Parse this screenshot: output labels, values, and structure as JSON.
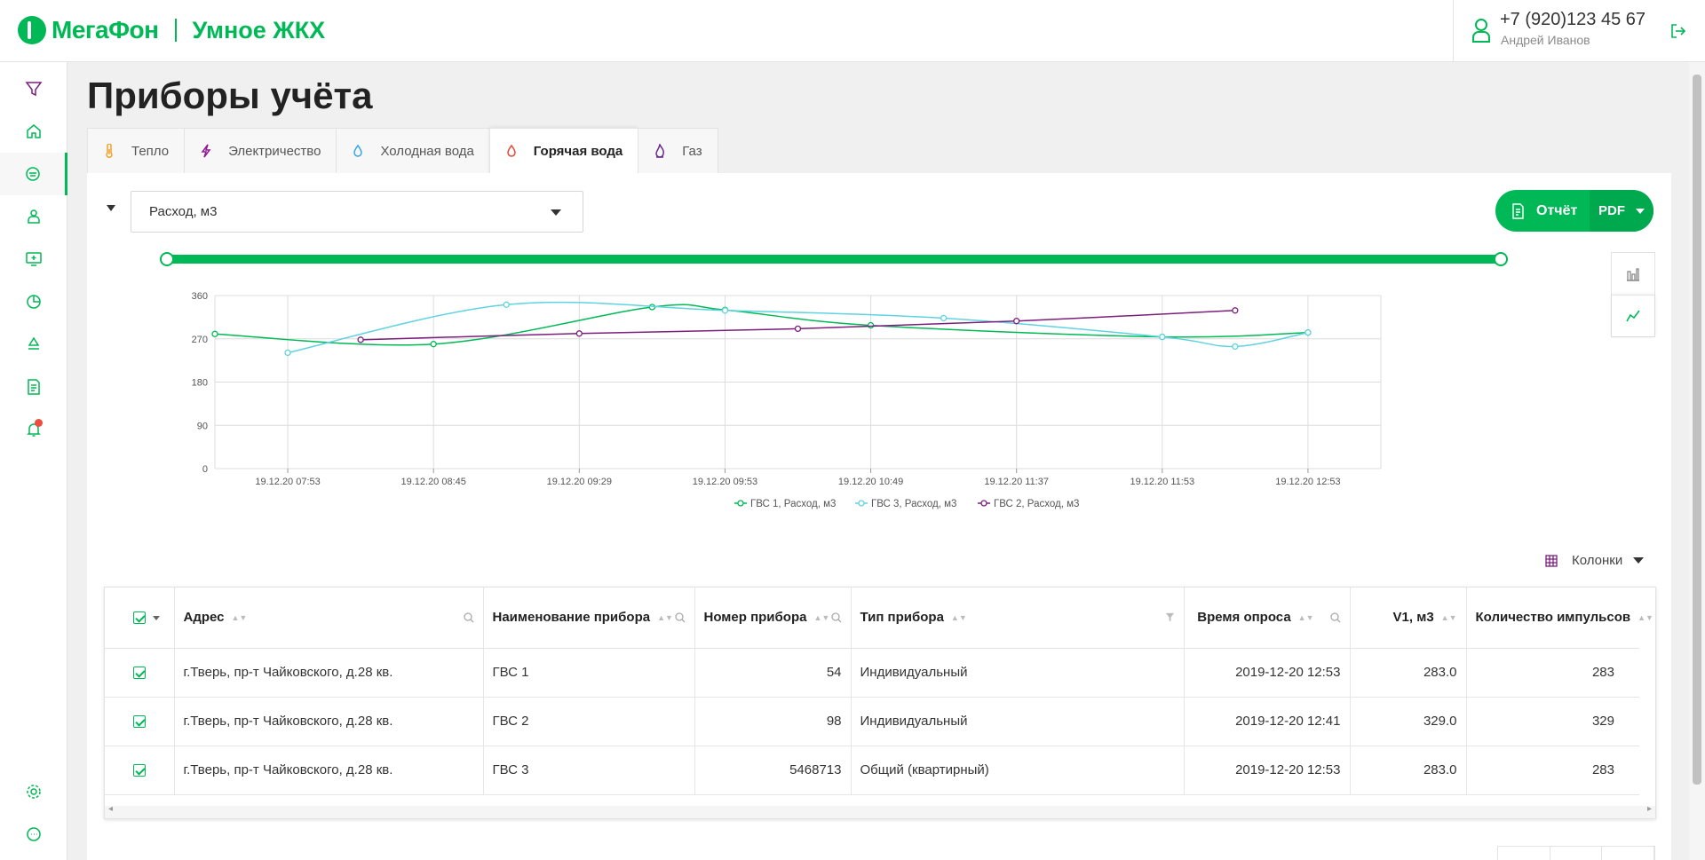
{
  "header": {
    "brand": "МегаФон",
    "product": "Умное ЖКХ",
    "user_phone": "+7 (920)123 45 67",
    "user_name": "Андрей Иванов"
  },
  "sidebar": {
    "items": [
      {
        "icon": "filter-icon"
      },
      {
        "icon": "home-icon"
      },
      {
        "icon": "meter-icon",
        "active": true
      },
      {
        "icon": "user-group-icon"
      },
      {
        "icon": "monitor-icon"
      },
      {
        "icon": "pie-chart-icon"
      },
      {
        "icon": "recycle-icon"
      },
      {
        "icon": "document-icon"
      },
      {
        "icon": "bell-icon",
        "badge": true
      },
      {
        "icon": "settings-icon"
      },
      {
        "icon": "chat-icon"
      }
    ]
  },
  "page": {
    "title": "Приборы учёта"
  },
  "tabs": [
    {
      "label": "Тепло",
      "icon": "thermometer-icon",
      "color": "#f2a12b"
    },
    {
      "label": "Электричество",
      "icon": "lightning-icon",
      "color": "#8e1b8f"
    },
    {
      "label": "Холодная вода",
      "icon": "water-drop-icon",
      "color": "#3aa8e0"
    },
    {
      "label": "Горячая вода",
      "icon": "hot-water-drop-icon",
      "color": "#e84a3a",
      "active": true
    },
    {
      "label": "Газ",
      "icon": "gas-flame-icon",
      "color": "#6b2a8a"
    }
  ],
  "filter": {
    "selected": "Расход, м3"
  },
  "report": {
    "label": "Отчёт",
    "format": "PDF"
  },
  "colors": {
    "accent": "#00b956",
    "series1": "#00b956",
    "series2": "#5fd3e0",
    "series3": "#7b1f7d"
  },
  "chart_data": {
    "type": "line",
    "ylim": [
      0,
      360
    ],
    "yticks": [
      0,
      90,
      180,
      270,
      360
    ],
    "categories": [
      "19.12.20 07:53",
      "19.12.20 08:45",
      "19.12.20 09:29",
      "19.12.20 09:53",
      "19.12.20 10:49",
      "19.12.20 11:37",
      "19.12.20 11:53",
      "19.12.20 12:53"
    ],
    "series": [
      {
        "name": "ГВС 1, Расход, м3",
        "color": "#00b956",
        "points": [
          [
            -0.5,
            280
          ],
          [
            1,
            259
          ],
          [
            2.5,
            336
          ],
          [
            3,
            330
          ],
          [
            4,
            298
          ],
          [
            6,
            274
          ],
          [
            7,
            283
          ]
        ]
      },
      {
        "name": "ГВС 3, Расход, м3",
        "color": "#5fd3e0",
        "points": [
          [
            0,
            241
          ],
          [
            1.5,
            341
          ],
          [
            3,
            329
          ],
          [
            4.5,
            313
          ],
          [
            6,
            274
          ],
          [
            6.5,
            254
          ],
          [
            7,
            283
          ]
        ]
      },
      {
        "name": "ГВС 2, Расход, м3",
        "color": "#7b1f7d",
        "points": [
          [
            0.5,
            268
          ],
          [
            2,
            281
          ],
          [
            3.5,
            291
          ],
          [
            5,
            307
          ],
          [
            6.5,
            329
          ]
        ]
      }
    ]
  },
  "columns_label": "Колонки",
  "table": {
    "headers": {
      "address": "Адрес",
      "device_name": "Наименование прибора",
      "device_number": "Номер прибора",
      "device_type": "Тип прибора",
      "poll_time": "Время опроса",
      "v1": "V1, м3",
      "pulses": "Количество импульсов"
    },
    "rows": [
      {
        "address": "г.Тверь, пр-т Чайковского, д.28 кв.",
        "device_name": "ГВС 1",
        "device_number": "54",
        "device_type": "Индивидуальный",
        "poll_time": "2019-12-20 12:53",
        "v1": "283.0",
        "pulses": "283"
      },
      {
        "address": "г.Тверь, пр-т Чайковского, д.28 кв.",
        "device_name": "ГВС 2",
        "device_number": "98",
        "device_type": "Индивидуальный",
        "poll_time": "2019-12-20 12:41",
        "v1": "329.0",
        "pulses": "329"
      },
      {
        "address": "г.Тверь, пр-т Чайковского, д.28 кв.",
        "device_name": "ГВС 3",
        "device_number": "5468713",
        "device_type": "Общий (квартирный)",
        "poll_time": "2019-12-20 12:53",
        "v1": "283.0",
        "pulses": "283"
      }
    ]
  }
}
